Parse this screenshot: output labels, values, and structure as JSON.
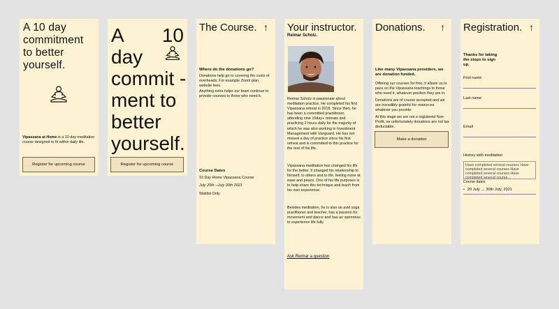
{
  "card1": {
    "headline": "A 10 day commitment to better yourself.",
    "intro_bold": "Vipassana at Home",
    "intro_rest": " is a 10 day meditation course designed to fit within daily life.",
    "button": "Register for upcoming course",
    "icon": "meditation-icon"
  },
  "card2": {
    "line1": "A",
    "line1b": "10",
    "rest": "day commit -ment to better yourself.",
    "button": "Register for upcoming course",
    "icon": "meditation-icon"
  },
  "course": {
    "title": "The Course.",
    "arrow": "↑",
    "q": "Where do the donations go?",
    "p1": "Donations help go to covering the costs of overheads. For example Zoom plan, website fees.",
    "p2": "Anything extra helps our team continue to provide courses to those who need it.",
    "dates_title": "Course Dates",
    "course_name": "10 Day Home Vipassana Course",
    "dates": "July 20th --July 30th 2021",
    "waitlist": "Waitlist Only"
  },
  "instructor": {
    "title": "Your instructor.",
    "name": "Reimar Scholz.",
    "bio1": "Reimar Scholz is passionate about meditation practice. He completed his first Vipassana retreat in 2018. Since then, he has been a committed practitioner, attending nine 10day+ retreats and practicing 2 hours daily for the majority of which he was also working in Investment Management with Vanguard. He has not missed a day of practice since his first retreat and is committed to this practice for the rest of his life.",
    "bio2": "Vipassana meditation has changed his life for the better. It changed his relationship to himself, to others and to life, feeling more at ease and peace. One of his life purposes is to help share this technique and teach from his own experience.",
    "bio3": "Besides meditation, he is also an avid yoga practitioner and teacher, has a passion for movement and dance and has an openness to experience life fully.",
    "ask": "Ask Reimar a question"
  },
  "donations": {
    "title": "Donations.",
    "arrow": "↑",
    "bold": "Like many Vipassana providers, we are donation funded.",
    "p1": "Offering our courses for free; it allows us to pass on the Vipassana teachings to those who need it, whatever position they are in.",
    "p2": "Donations are of course accepted and we are incredibly grateful for resources whatever you provide.",
    "p3": "At this stage we are not a registered Non-Profit, so unfortunately donations are not tax deductable.",
    "button": "Make a donation"
  },
  "registration": {
    "title": "Registration.",
    "arrow": "↑",
    "thanks": "Thanks for taking the steps to sign up.",
    "first": "First name",
    "last": "Last name",
    "email": "Email",
    "history": "History with meditation",
    "history_value": "Have completed several courses Have completed several courses Have completed several courses Have completed several course...",
    "dates_label": "Course dates",
    "date_option": "20 July → 30th July, 2021"
  }
}
